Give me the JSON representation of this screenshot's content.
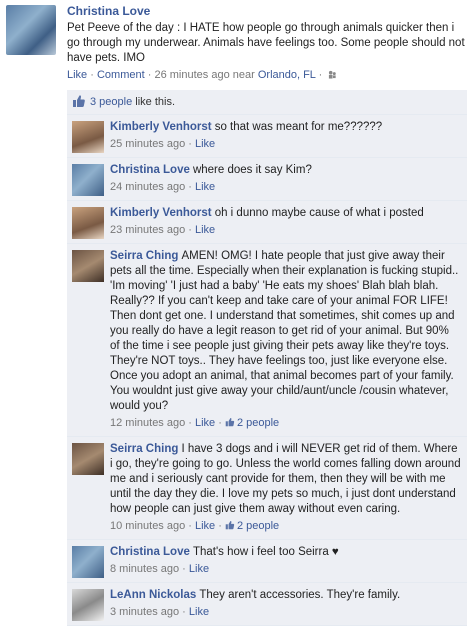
{
  "post": {
    "author": "Christina Love",
    "text": "Pet Peeve of the day : I HATE how people go through animals quicker then i go through my underwear. Animals have feelings too. Some people should not have pets. IMO",
    "like": "Like",
    "comment": "Comment",
    "time": "26 minutes ago",
    "near": "near",
    "location": "Orlando, FL",
    "dot": "·"
  },
  "likes": {
    "count_link": "3 people",
    "suffix": "like this."
  },
  "comments": [
    {
      "name": "Kimberly Venhorst",
      "text": "so that was meant for me??????",
      "time": "25 minutes ago",
      "like": "Like"
    },
    {
      "name": "Christina Love",
      "text": "where does it say Kim?",
      "time": "24 minutes ago",
      "like": "Like"
    },
    {
      "name": "Kimberly Venhorst",
      "text": "oh i dunno maybe cause of what i posted",
      "time": "23 minutes ago",
      "like": "Like"
    },
    {
      "name": "Seirra Ching",
      "text": "AMEN! OMG! I hate people that just give away their pets all the time. Especially when their explanation is fucking stupid.. 'Im moving' 'I just had a baby' 'He eats my shoes' Blah blah blah. Really?? If you can't keep and take care of your animal FOR LIFE! Then dont get one. I understand that sometimes, shit comes up and you really do have a legit reason to get rid of your animal. But 90% of the time i see people just giving their pets away like they're toys. They're NOT toys.. They have feelings too, just like everyone else. Once you adopt an animal, that animal becomes part of your family. You wouldnt just give away your child/aunt/uncle /cousin whatever, would you?",
      "time": "12 minutes ago",
      "like": "Like",
      "likes": "2 people"
    },
    {
      "name": "Seirra Ching",
      "text": "I have 3 dogs and i will NEVER get rid of them. Where i go, they're going to go. Unless the world comes falling down around me and i seriously cant provide for them, then they will be with me until the day they die. I love my pets so much, i just dont understand how people can just give them away without even caring.",
      "time": "10 minutes ago",
      "like": "Like",
      "likes": "2 people"
    },
    {
      "name": "Christina Love",
      "text": "That's how i feel too Seirra ♥",
      "time": "8 minutes ago",
      "like": "Like"
    },
    {
      "name": "LeAnn Nickolas",
      "text": "They aren't accessories. They're family.",
      "time": "3 minutes ago",
      "like": "Like"
    }
  ],
  "colors": {
    "link": "#3b5998",
    "ufi_bg": "#edeff4",
    "meta": "#777777"
  },
  "icons": {
    "location": "pin-icon",
    "like": "thumbs-up-icon"
  }
}
